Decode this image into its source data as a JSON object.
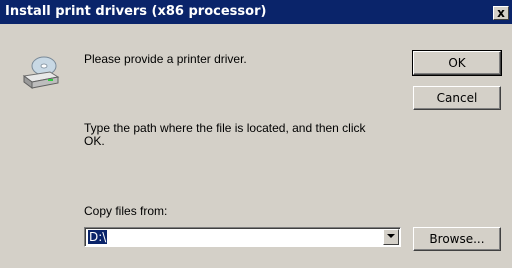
{
  "window": {
    "title": "Install print drivers (x86 processor)",
    "close_glyph": "x"
  },
  "message": {
    "prompt": "Please provide a printer driver.",
    "instructions_line1": "Type the path where the file is located, and then click",
    "instructions_line2": "OK."
  },
  "buttons": {
    "ok": "OK",
    "cancel": "Cancel",
    "browse": "Browse..."
  },
  "copy_from": {
    "label": "Copy files from:",
    "value": "D:\\"
  },
  "icons": {
    "dialog_icon": "disk-drive-icon",
    "dropdown": "chevron-down-icon"
  },
  "colors": {
    "titlebar": "#0a246a",
    "dialog_bg": "#d4d0c8",
    "selection": "#0a246a"
  }
}
